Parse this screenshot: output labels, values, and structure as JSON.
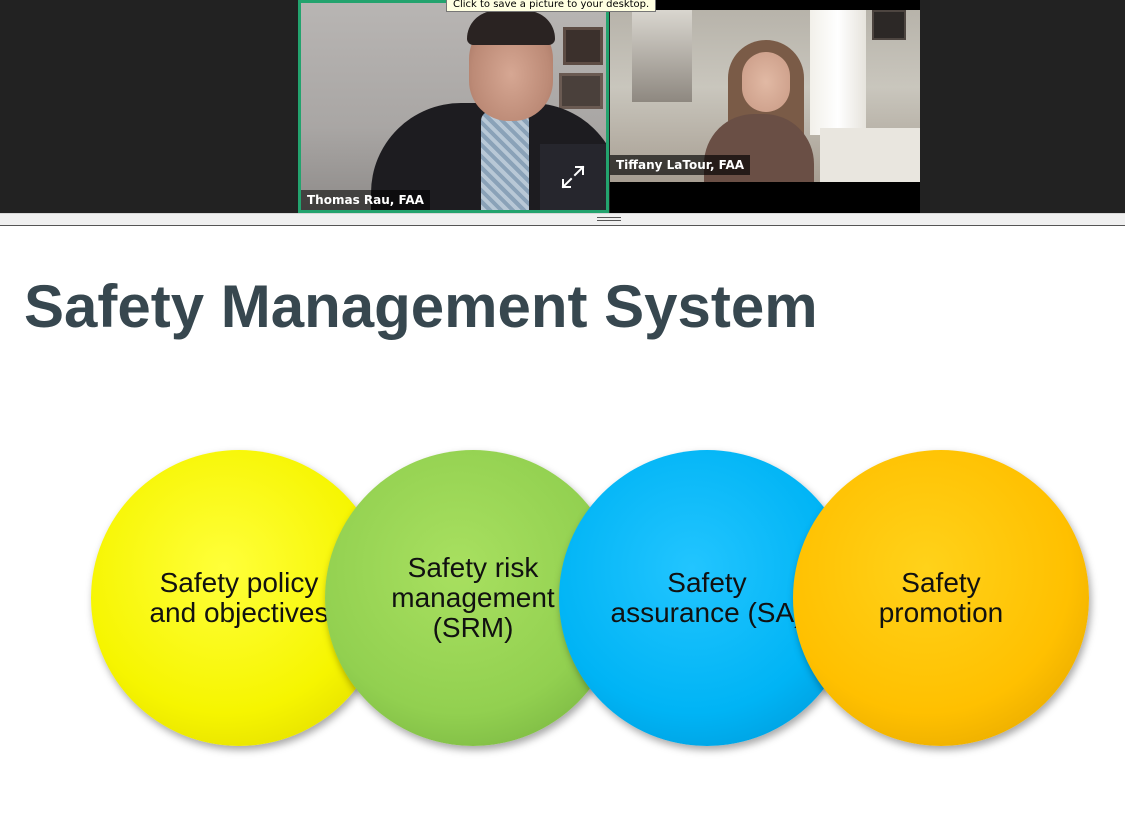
{
  "tooltip": {
    "text": "Click to save a picture to your desktop."
  },
  "participants": [
    {
      "name": "Thomas Rau, FAA",
      "active_speaker": true
    },
    {
      "name": "Tiffany LaTour, FAA",
      "active_speaker": false
    }
  ],
  "icons": {
    "expand": "expand-arrows-icon",
    "splitter": "drag-grip-icon"
  },
  "colors": {
    "active_speaker_border": "#23a36e",
    "title": "#37474f",
    "circle_1": "#f6f500",
    "circle_2": "#92d050",
    "circle_3": "#00b4f5",
    "circle_4": "#ffc000"
  },
  "slide": {
    "title": "Safety Management System",
    "circles": [
      {
        "label": "Safety policy and objectives"
      },
      {
        "label": "Safety risk management (SRM)"
      },
      {
        "label": "Safety assurance (SA)"
      },
      {
        "label": "Safety promotion"
      }
    ]
  }
}
